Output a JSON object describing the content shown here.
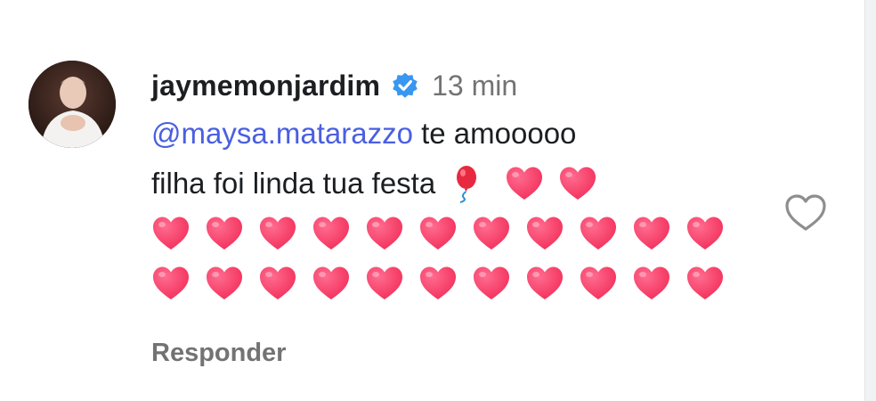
{
  "comment": {
    "username": "jaymemonjardim",
    "verified": true,
    "time": "13 min",
    "mention": "@maysa.matarazzo",
    "text_line1_rest": " te amooooo",
    "text_line2": "filha foi linda tua festa",
    "emoji_line2": [
      "balloon",
      "heart",
      "heart"
    ],
    "heart_rows": [
      11,
      11
    ],
    "reply_label": "Responder",
    "like_icon": "heart-outline-icon"
  },
  "colors": {
    "mention": "#4a5fe0",
    "verified_badge": "#3897f0",
    "heart_fill": "#f2305b",
    "muted_text": "#737373"
  }
}
